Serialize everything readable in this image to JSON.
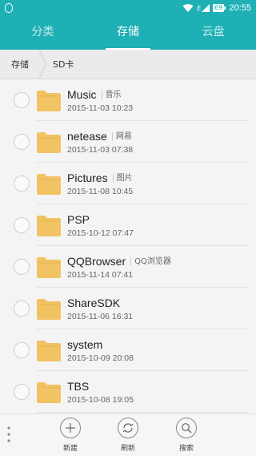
{
  "status_bar": {
    "network_label": "E",
    "battery": "69",
    "time": "20:55"
  },
  "tabs": [
    {
      "label": "分类",
      "active": false
    },
    {
      "label": "存储",
      "active": true
    },
    {
      "label": "云盘",
      "active": false
    }
  ],
  "breadcrumb": [
    "存储",
    "SD卡"
  ],
  "files": [
    {
      "name": "Music",
      "alias": "音乐",
      "date": "2015-11-03 10:23"
    },
    {
      "name": "netease",
      "alias": "网易",
      "date": "2015-11-03 07:38"
    },
    {
      "name": "Pictures",
      "alias": "图片",
      "date": "2015-11-08 10:45"
    },
    {
      "name": "PSP",
      "alias": "",
      "date": "2015-10-12 07:47"
    },
    {
      "name": "QQBrowser",
      "alias": "QQ浏览器",
      "date": "2015-11-14 07:41"
    },
    {
      "name": "ShareSDK",
      "alias": "",
      "date": "2015-11-06 16:31"
    },
    {
      "name": "system",
      "alias": "",
      "date": "2015-10-09 20:08"
    },
    {
      "name": "TBS",
      "alias": "",
      "date": "2015-10-08 19:05"
    }
  ],
  "bottom_actions": [
    {
      "label": "新建",
      "icon": "plus-icon"
    },
    {
      "label": "刷新",
      "icon": "refresh-icon"
    },
    {
      "label": "搜索",
      "icon": "search-icon"
    }
  ],
  "colors": {
    "accent": "#1fb0b6",
    "folder": "#f2c363"
  }
}
